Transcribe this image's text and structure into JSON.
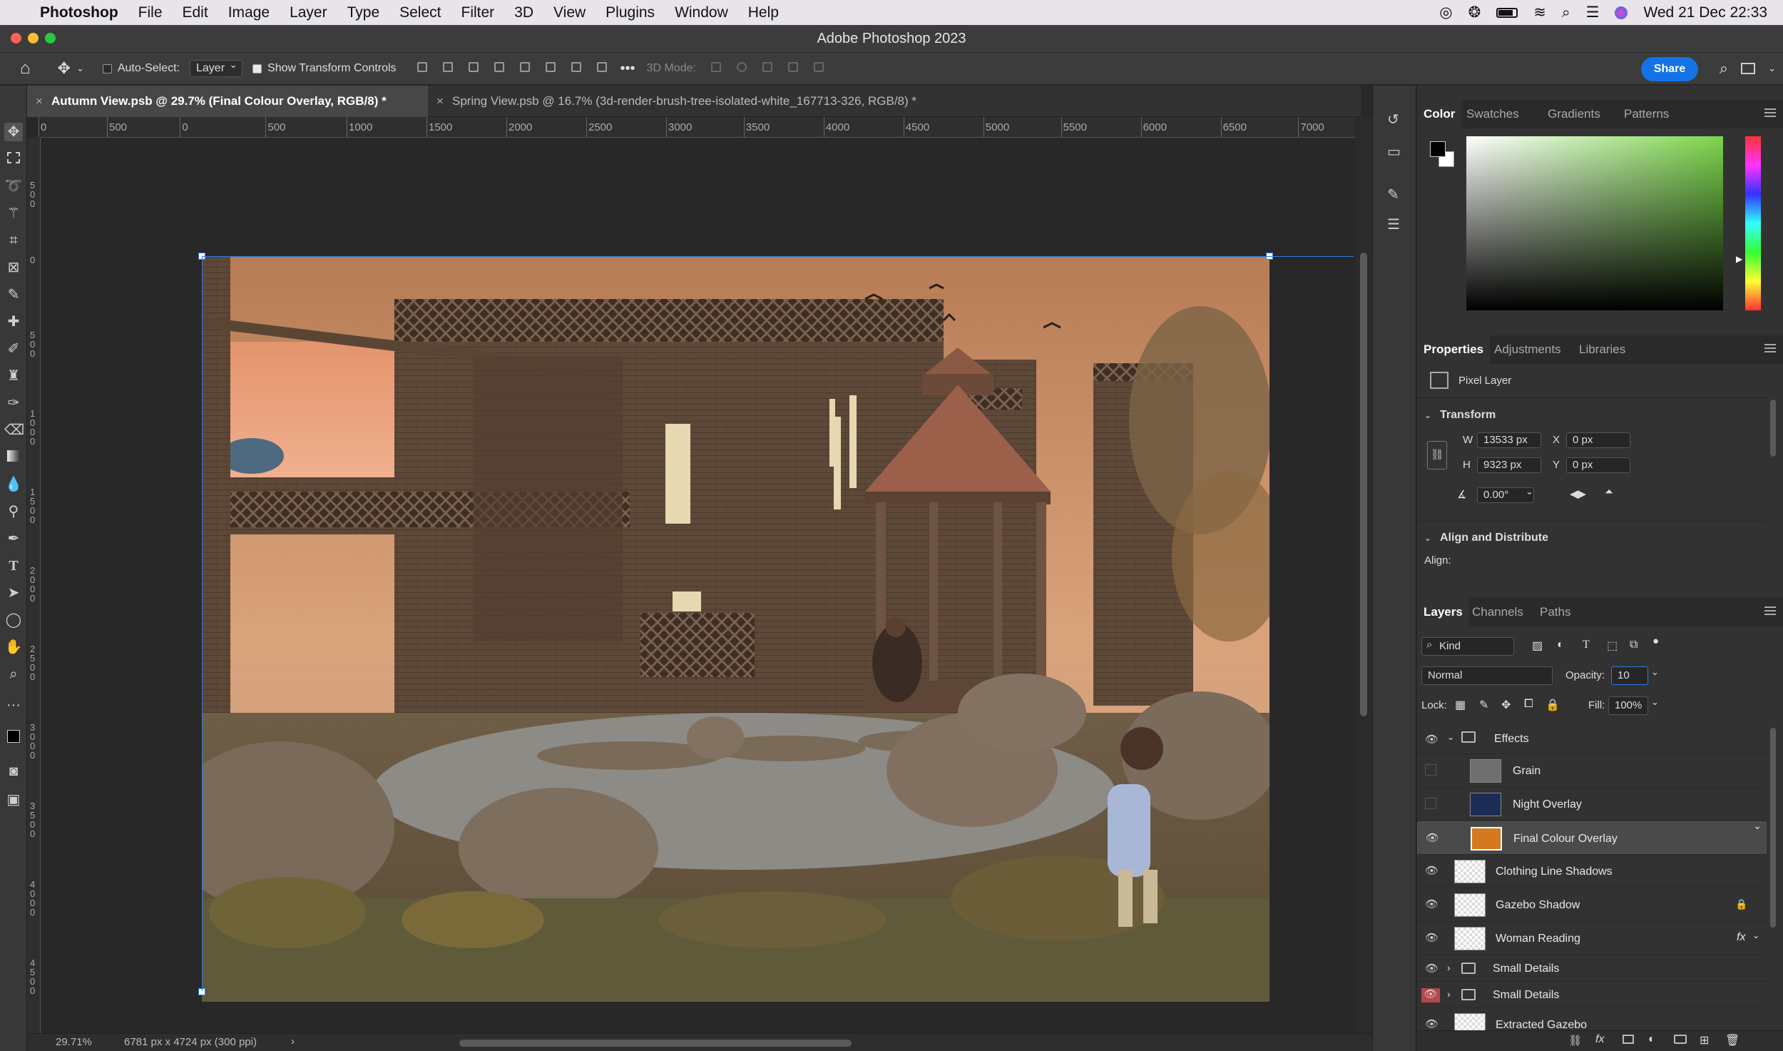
{
  "menubar": {
    "app_name": "Photoshop",
    "items": [
      "File",
      "Edit",
      "Image",
      "Layer",
      "Type",
      "Select",
      "Filter",
      "3D",
      "View",
      "Plugins",
      "Window",
      "Help"
    ],
    "datetime": "Wed 21 Dec  22:33"
  },
  "window": {
    "title": "Adobe Photoshop 2023"
  },
  "options_bar": {
    "auto_select_label": "Auto-Select:",
    "auto_select_value": "Layer",
    "show_transform_label": "Show Transform Controls",
    "mode_3d_label": "3D Mode:",
    "share_label": "Share"
  },
  "doc_tabs": [
    {
      "label": "Autumn View.psb @ 29.7% (Final Colour Overlay, RGB/8) *",
      "active": true
    },
    {
      "label": "Spring View.psb @ 16.7% (3d-render-brush-tree-isolated-white_167713-326, RGB/8) *",
      "active": false
    }
  ],
  "ruler": {
    "h_ticks": [
      "0",
      "500",
      "0",
      "500",
      "1000",
      "1500",
      "2000",
      "2500",
      "3000",
      "3500",
      "4000",
      "4500",
      "5000",
      "5500",
      "6000",
      "6500",
      "7000"
    ],
    "v_ticks": [
      "500",
      "0",
      "500",
      "1000",
      "1500",
      "2000",
      "2500",
      "3000",
      "3500",
      "4000",
      "4500"
    ]
  },
  "status": {
    "zoom": "29.71%",
    "doc_size": "6781 px x 4724 px (300 ppi)"
  },
  "color_panel": {
    "tabs": [
      "Color",
      "Swatches",
      "Gradients",
      "Patterns"
    ],
    "hue_color": "#7bd64a"
  },
  "properties_panel": {
    "tabs": [
      "Properties",
      "Adjustments",
      "Libraries"
    ],
    "layer_type": "Pixel Layer",
    "transform_label": "Transform",
    "w_label": "W",
    "w_value": "13533 px",
    "h_label": "H",
    "h_value": "9323 px",
    "x_label": "X",
    "x_value": "0 px",
    "y_label": "Y",
    "y_value": "0 px",
    "angle_value": "0.00°",
    "align_section": "Align and Distribute",
    "align_label": "Align:"
  },
  "layers_panel": {
    "tabs": [
      "Layers",
      "Channels",
      "Paths"
    ],
    "filter_kind": "Kind",
    "blend_mode": "Normal",
    "opacity_label": "Opacity:",
    "opacity_value": "10",
    "lock_label": "Lock:",
    "fill_label": "Fill:",
    "fill_value": "100%",
    "layers": [
      {
        "name": "Effects",
        "kind": "group",
        "visible": true
      },
      {
        "name": "Grain",
        "kind": "pixel",
        "visible": false,
        "thumb_color": "#6f6f6f"
      },
      {
        "name": "Night Overlay",
        "kind": "pixel",
        "visible": false,
        "thumb_color": "#1c2d55"
      },
      {
        "name": "Final Colour Overlay",
        "kind": "pixel",
        "visible": true,
        "thumb_color": "#d4791f",
        "selected": true
      },
      {
        "name": "Clothing Line Shadows",
        "kind": "pixel",
        "visible": true
      },
      {
        "name": "Gazebo Shadow",
        "kind": "pixel",
        "visible": true,
        "locked": true
      },
      {
        "name": "Woman Reading",
        "kind": "pixel",
        "visible": true,
        "fx": true
      },
      {
        "name": "Small Details",
        "kind": "group",
        "visible": true
      },
      {
        "name": "Small Details",
        "kind": "group",
        "visible": true,
        "highlight_eye": true
      },
      {
        "name": "Extracted Gazebo",
        "kind": "pixel",
        "visible": true
      }
    ]
  }
}
